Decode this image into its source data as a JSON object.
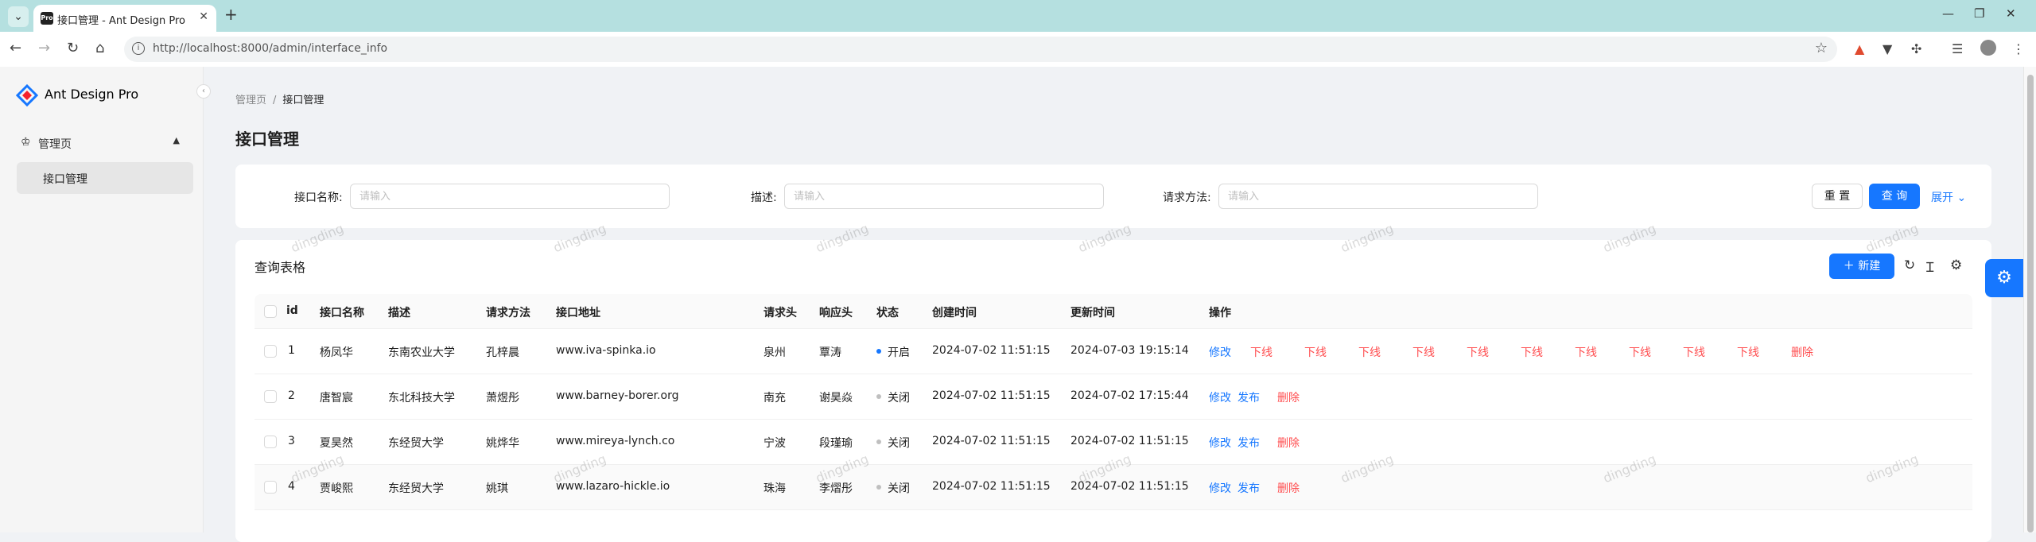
{
  "browser": {
    "tab_title": "接口管理 - Ant Design Pro",
    "favicon_text": "Pro",
    "url": "http://localhost:8000/admin/interface_info"
  },
  "sider": {
    "logo_text": "Ant Design Pro",
    "group_label": "管理页",
    "item_label": "接口管理"
  },
  "breadcrumb": [
    "管理页",
    "接口管理"
  ],
  "breadcrumb_sep": "/",
  "page_title": "接口管理",
  "search": {
    "fields": [
      {
        "label": "接口名称:",
        "placeholder": "请输入"
      },
      {
        "label": "描述:",
        "placeholder": "请输入"
      },
      {
        "label": "请求方法:",
        "placeholder": "请输入"
      }
    ],
    "reset_label": "重 置",
    "query_label": "查 询",
    "expand_label": "展开"
  },
  "table": {
    "title": "查询表格",
    "new_label": "新建",
    "columns": [
      "id",
      "接口名称",
      "描述",
      "请求方法",
      "接口地址",
      "请求头",
      "响应头",
      "状态",
      "创建时间",
      "更新时间",
      "操作"
    ],
    "rows": [
      {
        "id": "1",
        "name": "杨凤华",
        "desc": "东南农业大学",
        "method": "孔梓晨",
        "url": "www.iva-spinka.io",
        "req": "泉州",
        "resp": "覃涛",
        "status": "开启",
        "status_color": "#1677ff",
        "created": "2024-07-02 11:51:15",
        "updated": "2024-07-03 19:15:14"
      },
      {
        "id": "2",
        "name": "唐智宸",
        "desc": "东北科技大学",
        "method": "萧煜彤",
        "url": "www.barney-borer.org",
        "req": "南充",
        "resp": "谢昊焱",
        "status": "关闭",
        "status_color": "#bfbfbf",
        "created": "2024-07-02 11:51:15",
        "updated": "2024-07-02 17:15:44"
      },
      {
        "id": "3",
        "name": "夏昊然",
        "desc": "东经贸大学",
        "method": "姚烨华",
        "url": "www.mireya-lynch.co",
        "req": "宁波",
        "resp": "段瑾瑜",
        "status": "关闭",
        "status_color": "#bfbfbf",
        "created": "2024-07-02 11:51:15",
        "updated": "2024-07-02 11:51:15"
      },
      {
        "id": "4",
        "name": "贾峻熙",
        "desc": "东经贸大学",
        "method": "姚琪",
        "url": "www.lazaro-hickle.io",
        "req": "珠海",
        "resp": "李熠彤",
        "status": "关闭",
        "status_color": "#bfbfbf",
        "created": "2024-07-02 11:51:15",
        "updated": "2024-07-02 11:51:15"
      }
    ],
    "row1_actions": [
      "修改",
      "下线",
      "下线",
      "下线",
      "下线",
      "下线",
      "下线",
      "下线",
      "下线",
      "下线",
      "下线",
      "删除"
    ],
    "row_actions": [
      "修改",
      "发布",
      "删除"
    ]
  },
  "watermark_text": "dingding",
  "colors": {
    "primary": "#1677ff",
    "danger": "#ff4d4f"
  }
}
